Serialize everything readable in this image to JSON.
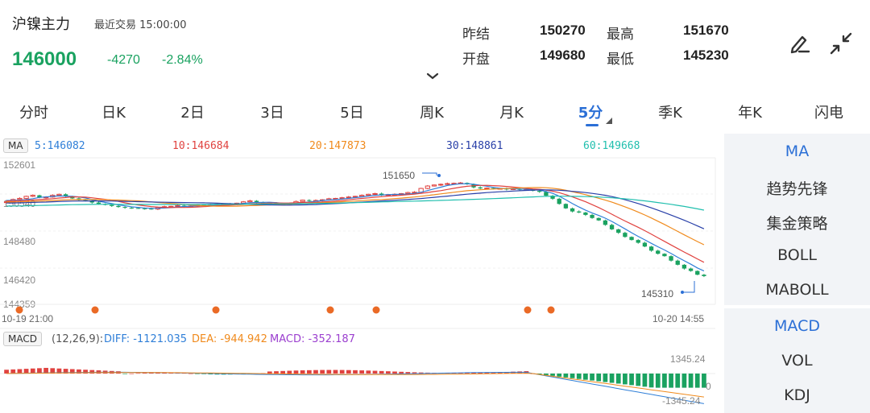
{
  "header": {
    "title": "沪镍主力",
    "time": "最近交易  15:00:00",
    "price": "146000",
    "change": "-4270",
    "change_pct": "-2.84%",
    "quotes": [
      {
        "label": "昨结",
        "value": "150270"
      },
      {
        "label": "最高",
        "value": "151670"
      },
      {
        "label": "开盘",
        "value": "149680"
      },
      {
        "label": "最低",
        "value": "145230"
      }
    ],
    "icons": [
      "edit-pen-icon",
      "collapse-arrows-icon",
      "chevron-down-icon"
    ]
  },
  "tabs": [
    "分时",
    "日K",
    "2日",
    "3日",
    "5日",
    "周K",
    "月K",
    "5分",
    "季K",
    "年K",
    "闪电"
  ],
  "active_tab": "5分",
  "ma_labels": [
    {
      "text": "5:146082",
      "color": "#2f7fd8"
    },
    {
      "text": "10:146684",
      "color": "#e0423f"
    },
    {
      "text": "20:147873",
      "color": "#f08a1c"
    },
    {
      "text": "30:148861",
      "color": "#283fa8"
    },
    {
      "text": "60:149668",
      "color": "#21bfae"
    }
  ],
  "ma_tag": "MA",
  "price_axis": [
    "152601",
    "150540",
    "148480",
    "146420",
    "144359"
  ],
  "peak_label": "151650",
  "low_label": "145310",
  "time_start": "10-19 21:00",
  "time_end": "10-20 14:55",
  "macd_tag": "MACD",
  "macd_params": "(12,26,9):",
  "macd_diff": "DIFF: -1121.035",
  "macd_dea": "DEA: -944.942",
  "macd_macd": "MACD: -352.187",
  "macd_axis_top": "1345.24",
  "macd_axis_zero": "0",
  "macd_axis_bottom": "-1345.24",
  "side_group1": [
    "MA",
    "趋势先锋",
    "集金策略",
    "BOLL",
    "MABOLL"
  ],
  "side_group2": [
    "MACD",
    "VOL",
    "KDJ"
  ],
  "colors": {
    "up": "#e0423f",
    "down": "#1aa260",
    "accent": "#2b6fd6"
  },
  "chart_data": {
    "type": "candlestick",
    "ylim": [
      144359,
      152601
    ],
    "close": [
      150320,
      150460,
      150520,
      150640,
      150700,
      150560,
      150600,
      150700,
      150760,
      150640,
      150520,
      150420,
      150380,
      150280,
      150200,
      150140,
      150080,
      150020,
      149980,
      149960,
      149940,
      149920,
      149900,
      150000,
      150040,
      150060,
      150100,
      150040,
      150080,
      150140,
      150120,
      150160,
      150180,
      150200,
      150200,
      150240,
      150320,
      150380,
      150280,
      150240,
      150260,
      150200,
      150200,
      150220,
      150340,
      150420,
      150380,
      150400,
      150440,
      150500,
      150520,
      150560,
      150600,
      150640,
      150700,
      150760,
      150800,
      150700,
      150740,
      150760,
      150800,
      150860,
      150880,
      151100,
      151240,
      151300,
      151340,
      151380,
      151400,
      151420,
      151340,
      151160,
      151100,
      151120,
      151080,
      151100,
      151040,
      151080,
      151020,
      151040,
      150960,
      150900,
      150680,
      150500,
      150200,
      149940,
      149760,
      149700,
      149560,
      149380,
      149240,
      148980,
      148720,
      148520,
      148280,
      148100,
      147940,
      147720,
      147480,
      147300,
      147160,
      146900,
      146660,
      146440,
      146300,
      146080,
      146000
    ]
  }
}
